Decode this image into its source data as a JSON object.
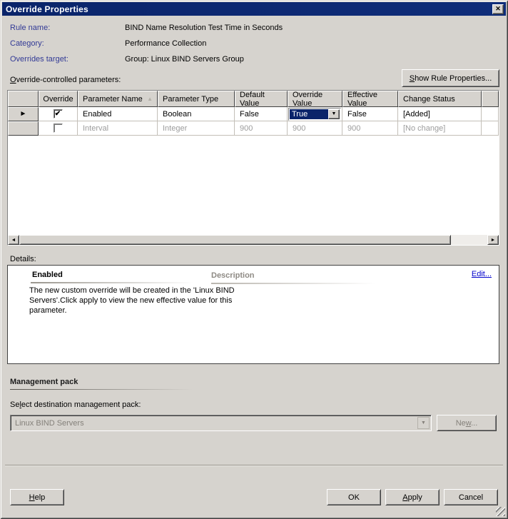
{
  "window": {
    "title": "Override Properties"
  },
  "icons": {
    "close": "✕",
    "checkmark": "✔",
    "dropdown_arrow": "▼",
    "sort_ascending": "▲",
    "row_selector": "►",
    "scroll_left": "◄",
    "scroll_right": "►"
  },
  "header": {
    "rule_name_label": "Rule name:",
    "rule_name_value": "BIND Name Resolution Test Time in Seconds",
    "category_label": "Category:",
    "category_value": "Performance Collection",
    "overrides_target_label": "Overrides target:",
    "overrides_target_value": "Group: Linux BIND Servers Group"
  },
  "parameters_section": {
    "label": {
      "pre": "",
      "key": "O",
      "post": "verride-controlled parameters:"
    },
    "show_rule_properties_button": {
      "pre": "",
      "key": "S",
      "post": "how Rule Properties..."
    }
  },
  "table": {
    "columns": {
      "row_selector": "",
      "override": "Override",
      "parameter_name": "Parameter Name",
      "parameter_type": "Parameter Type",
      "default_value": "Default Value",
      "override_value": "Override Value",
      "effective_value": "Effective Value",
      "change_status": "Change Status"
    },
    "sort": {
      "column": "Parameter Name",
      "direction": "ascending"
    },
    "rows": [
      {
        "selected": true,
        "override_checked": true,
        "parameter_name": "Enabled",
        "parameter_type": "Boolean",
        "default_value": "False",
        "override_value": "True",
        "effective_value": "False",
        "change_status": "[Added]",
        "enabled": true
      },
      {
        "selected": false,
        "override_checked": false,
        "parameter_name": "Interval",
        "parameter_type": "Integer",
        "default_value": "900",
        "override_value": "900",
        "effective_value": "900",
        "change_status": "[No change]",
        "enabled": false
      }
    ]
  },
  "details_section": {
    "label": "Details:",
    "parameter_title": "Enabled",
    "body": "The new custom override will be created in the 'Linux BIND Servers'.Click apply to view  the new effective value for this parameter.",
    "description_header": "Description",
    "edit_link": "Edit..."
  },
  "management_pack_section": {
    "heading": "Management pack",
    "select_label": {
      "pre": "Se",
      "key": "l",
      "post": "ect destination management pack:"
    },
    "selected_pack": "Linux BIND Servers",
    "new_button": {
      "pre": "Ne",
      "key": "w",
      "post": "..."
    }
  },
  "footer": {
    "help_button": {
      "pre": "",
      "key": "H",
      "post": "elp"
    },
    "ok_button": "OK",
    "apply_button": {
      "pre": "",
      "key": "A",
      "post": "pply"
    },
    "cancel_button": "Cancel"
  },
  "colors": {
    "titlebar": "#0a246a",
    "dialog_face": "#d6d3ce",
    "label_blue": "#323a96",
    "selection": "#0a246a",
    "disabled_text": "#84807a",
    "link": "#0000cc"
  }
}
